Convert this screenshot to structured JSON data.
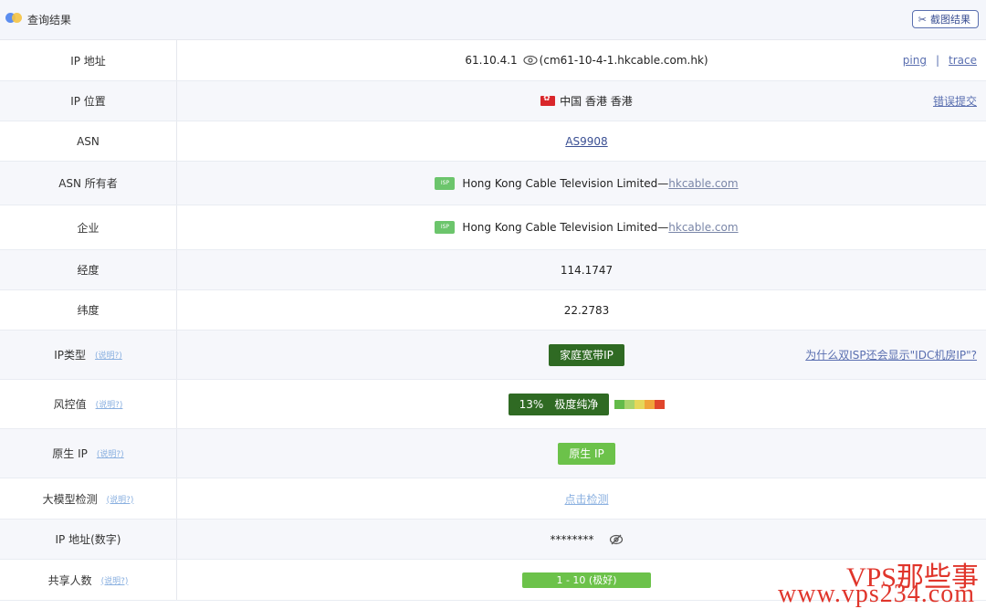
{
  "header": {
    "title": "查询结果",
    "screenshot_button": "截图结果",
    "icon": "scissors-icon"
  },
  "rows": {
    "ip": {
      "label": "IP 地址",
      "value_ip": "61.10.4.1",
      "value_host": "(cm61-10-4-1.hkcable.com.hk)",
      "ping": "ping",
      "sep": "|",
      "trace": "trace"
    },
    "location": {
      "label": "IP 位置",
      "value": "中国 香港 香港",
      "report": "错误提交",
      "flag": "hk-flag-icon"
    },
    "asn": {
      "label": "ASN",
      "value": "AS9908"
    },
    "asn_owner": {
      "label": "ASN 所有者",
      "tag": "ISP",
      "name": "Hong Kong Cable Television Limited— ",
      "domain": "hkcable.com"
    },
    "company": {
      "label": "企业",
      "tag": "ISP",
      "name": "Hong Kong Cable Television Limited— ",
      "domain": "hkcable.com"
    },
    "longitude": {
      "label": "经度",
      "value": "114.1747"
    },
    "latitude": {
      "label": "纬度",
      "value": "22.2783"
    },
    "ip_type": {
      "label": "IP类型",
      "help": "(说明?)",
      "value": "家庭宽带IP",
      "note": "为什么双ISP还会显示\"IDC机房IP\"?"
    },
    "risk": {
      "label": "风控值",
      "help": "(说明?)",
      "percent": "13%",
      "level": "极度纯净",
      "meter_colors": [
        "#63bb4a",
        "#a9d36b",
        "#e5d75a",
        "#f0a43a",
        "#e0452c"
      ]
    },
    "native": {
      "label": "原生 IP",
      "help": "(说明?)",
      "value": "原生 IP"
    },
    "llm": {
      "label": "大模型检测",
      "help": "(说明?)",
      "value": "点击检测"
    },
    "ip_numeric": {
      "label": "IP 地址(数字)",
      "value": "********"
    },
    "shared": {
      "label": "共享人数",
      "help": "(说明?)",
      "value": "1 - 10 (极好)"
    }
  },
  "watermark": {
    "line1": "VPS那些事",
    "line2": "www.vps234.com"
  }
}
